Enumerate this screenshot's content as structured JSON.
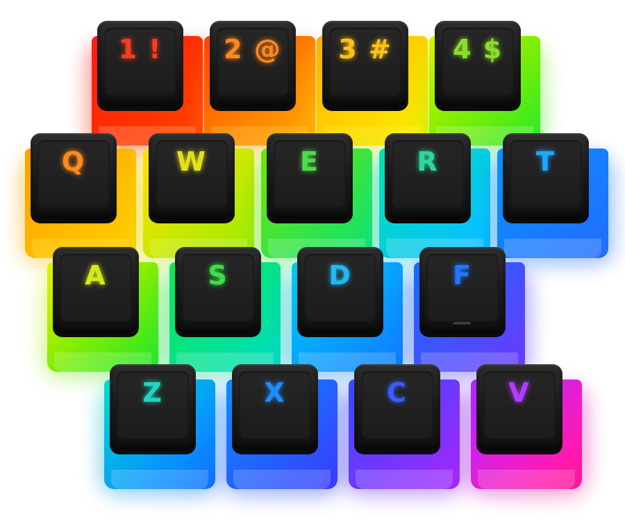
{
  "product": {
    "rows": [
      {
        "keys": [
          {
            "legend": "1 !",
            "color": "#ff3b1f",
            "skirt_top": "#ff1f1f",
            "skirt_bottom": "#ff4a00"
          },
          {
            "legend": "2 @",
            "color": "#ff8a1a",
            "skirt_top": "#ff4a00",
            "skirt_bottom": "#ffb000"
          },
          {
            "legend": "3 #",
            "color": "#ffc21a",
            "skirt_top": "#ffb000",
            "skirt_bottom": "#f3f000"
          },
          {
            "legend": "4 $",
            "color": "#8adf2a",
            "skirt_top": "#d9f000",
            "skirt_bottom": "#39e23a"
          }
        ]
      },
      {
        "keys": [
          {
            "legend": "Q",
            "color": "#ff8a1a",
            "skirt_top": "#ffa000",
            "skirt_bottom": "#ffd000"
          },
          {
            "legend": "W",
            "color": "#e4e01a",
            "skirt_top": "#ffe000",
            "skirt_bottom": "#9ee81c"
          },
          {
            "legend": "E",
            "color": "#4fdc4a",
            "skirt_top": "#7ae020",
            "skirt_bottom": "#1fdc78"
          },
          {
            "legend": "R",
            "color": "#2fd69a",
            "skirt_top": "#18dcae",
            "skirt_bottom": "#1bb7ff"
          },
          {
            "legend": "T",
            "color": "#1fa8ff",
            "skirt_top": "#1890ff",
            "skirt_bottom": "#2b6bff"
          }
        ]
      },
      {
        "keys": [
          {
            "legend": "A",
            "color": "#d6e81a",
            "skirt_top": "#e6f000",
            "skirt_bottom": "#2fe03a"
          },
          {
            "legend": "S",
            "color": "#3ae04a",
            "skirt_top": "#22e05a",
            "skirt_bottom": "#14d6c0"
          },
          {
            "legend": "D",
            "color": "#22b8f0",
            "skirt_top": "#14c8e0",
            "skirt_bottom": "#1a78ff"
          },
          {
            "legend": "F",
            "color": "#1f78ff",
            "skirt_top": "#1e6cff",
            "skirt_bottom": "#6a3cff",
            "homing": true
          }
        ]
      },
      {
        "keys": [
          {
            "legend": "Z",
            "color": "#1fd6c0",
            "skirt_top": "#12d8c8",
            "skirt_bottom": "#1a6cff"
          },
          {
            "legend": "X",
            "color": "#1f8cff",
            "skirt_top": "#1a8cff",
            "skirt_bottom": "#3a3cff"
          },
          {
            "legend": "C",
            "color": "#3a5cff",
            "skirt_top": "#3a4cff",
            "skirt_bottom": "#9a2cff"
          },
          {
            "legend": "V",
            "color": "#b43cff",
            "skirt_top": "#a02cff",
            "skirt_bottom": "#ff1f8a"
          }
        ]
      }
    ]
  }
}
